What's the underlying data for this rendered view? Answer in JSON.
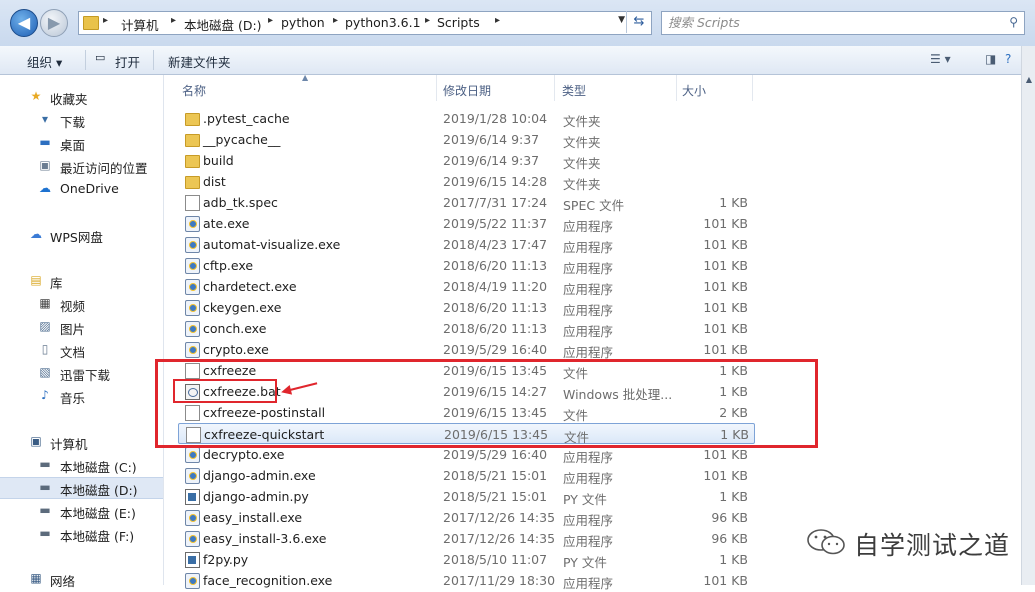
{
  "address_bar": {
    "breadcrumbs": [
      "计算机",
      "本地磁盘 (D:)",
      "python",
      "python3.6.1",
      "Scripts"
    ],
    "search_placeholder": "搜索 Scripts"
  },
  "toolbar": {
    "organize_label": "组织 ▾",
    "open_label": "打开",
    "new_folder_label": "新建文件夹"
  },
  "nav": {
    "favorites_label": "收藏夹",
    "favorites": [
      "下载",
      "桌面",
      "最近访问的位置",
      "OneDrive"
    ],
    "wps_label": "WPS网盘",
    "libraries_label": "库",
    "libraries": [
      "视频",
      "图片",
      "文档",
      "迅雷下载",
      "音乐"
    ],
    "computer_label": "计算机",
    "drives": [
      "本地磁盘 (C:)",
      "本地磁盘 (D:)",
      "本地磁盘 (E:)",
      "本地磁盘 (F:)"
    ],
    "network_label": "网络",
    "selected_drive": "本地磁盘 (D:)"
  },
  "columns": {
    "name": "名称",
    "date": "修改日期",
    "type": "类型",
    "size": "大小"
  },
  "files": [
    {
      "name": ".pytest_cache",
      "date": "2019/1/28 10:04",
      "type": "文件夹",
      "size": "",
      "icon": "folder"
    },
    {
      "name": "__pycache__",
      "date": "2019/6/14 9:37",
      "type": "文件夹",
      "size": "",
      "icon": "folder"
    },
    {
      "name": "build",
      "date": "2019/6/14 9:37",
      "type": "文件夹",
      "size": "",
      "icon": "folder"
    },
    {
      "name": "dist",
      "date": "2019/6/15 14:28",
      "type": "文件夹",
      "size": "",
      "icon": "folder"
    },
    {
      "name": "adb_tk.spec",
      "date": "2017/7/31 17:24",
      "type": "SPEC 文件",
      "size": "1 KB",
      "icon": "file"
    },
    {
      "name": "ate.exe",
      "date": "2019/5/22 11:37",
      "type": "应用程序",
      "size": "101 KB",
      "icon": "exe"
    },
    {
      "name": "automat-visualize.exe",
      "date": "2018/4/23 17:47",
      "type": "应用程序",
      "size": "101 KB",
      "icon": "exe"
    },
    {
      "name": "cftp.exe",
      "date": "2018/6/20 11:13",
      "type": "应用程序",
      "size": "101 KB",
      "icon": "exe"
    },
    {
      "name": "chardetect.exe",
      "date": "2018/4/19 11:20",
      "type": "应用程序",
      "size": "101 KB",
      "icon": "exe"
    },
    {
      "name": "ckeygen.exe",
      "date": "2018/6/20 11:13",
      "type": "应用程序",
      "size": "101 KB",
      "icon": "exe"
    },
    {
      "name": "conch.exe",
      "date": "2018/6/20 11:13",
      "type": "应用程序",
      "size": "101 KB",
      "icon": "exe"
    },
    {
      "name": "crypto.exe",
      "date": "2019/5/29 16:40",
      "type": "应用程序",
      "size": "101 KB",
      "icon": "exe"
    },
    {
      "name": "cxfreeze",
      "date": "2019/6/15 13:45",
      "type": "文件",
      "size": "1 KB",
      "icon": "file"
    },
    {
      "name": "cxfreeze.bat",
      "date": "2019/6/15 14:27",
      "type": "Windows 批处理...",
      "size": "1 KB",
      "icon": "bat"
    },
    {
      "name": "cxfreeze-postinstall",
      "date": "2019/6/15 13:45",
      "type": "文件",
      "size": "2 KB",
      "icon": "file"
    },
    {
      "name": "cxfreeze-quickstart",
      "date": "2019/6/15 13:45",
      "type": "文件",
      "size": "1 KB",
      "icon": "file"
    },
    {
      "name": "decrypto.exe",
      "date": "2019/5/29 16:40",
      "type": "应用程序",
      "size": "101 KB",
      "icon": "exe"
    },
    {
      "name": "django-admin.exe",
      "date": "2018/5/21 15:01",
      "type": "应用程序",
      "size": "101 KB",
      "icon": "exe"
    },
    {
      "name": "django-admin.py",
      "date": "2018/5/21 15:01",
      "type": "PY 文件",
      "size": "1 KB",
      "icon": "py"
    },
    {
      "name": "easy_install.exe",
      "date": "2017/12/26 14:35",
      "type": "应用程序",
      "size": "96 KB",
      "icon": "exe"
    },
    {
      "name": "easy_install-3.6.exe",
      "date": "2017/12/26 14:35",
      "type": "应用程序",
      "size": "96 KB",
      "icon": "exe"
    },
    {
      "name": "f2py.py",
      "date": "2018/5/10 11:07",
      "type": "PY 文件",
      "size": "1 KB",
      "icon": "py"
    },
    {
      "name": "face_recognition.exe",
      "date": "2017/11/29 18:30",
      "type": "应用程序",
      "size": "101 KB",
      "icon": "exe"
    }
  ],
  "selected_file": "cxfreeze-quickstart",
  "watermark": {
    "text": "自学测试之道"
  },
  "colors": {
    "annotation": "#e0262d",
    "selection": "#dbe8f8"
  }
}
